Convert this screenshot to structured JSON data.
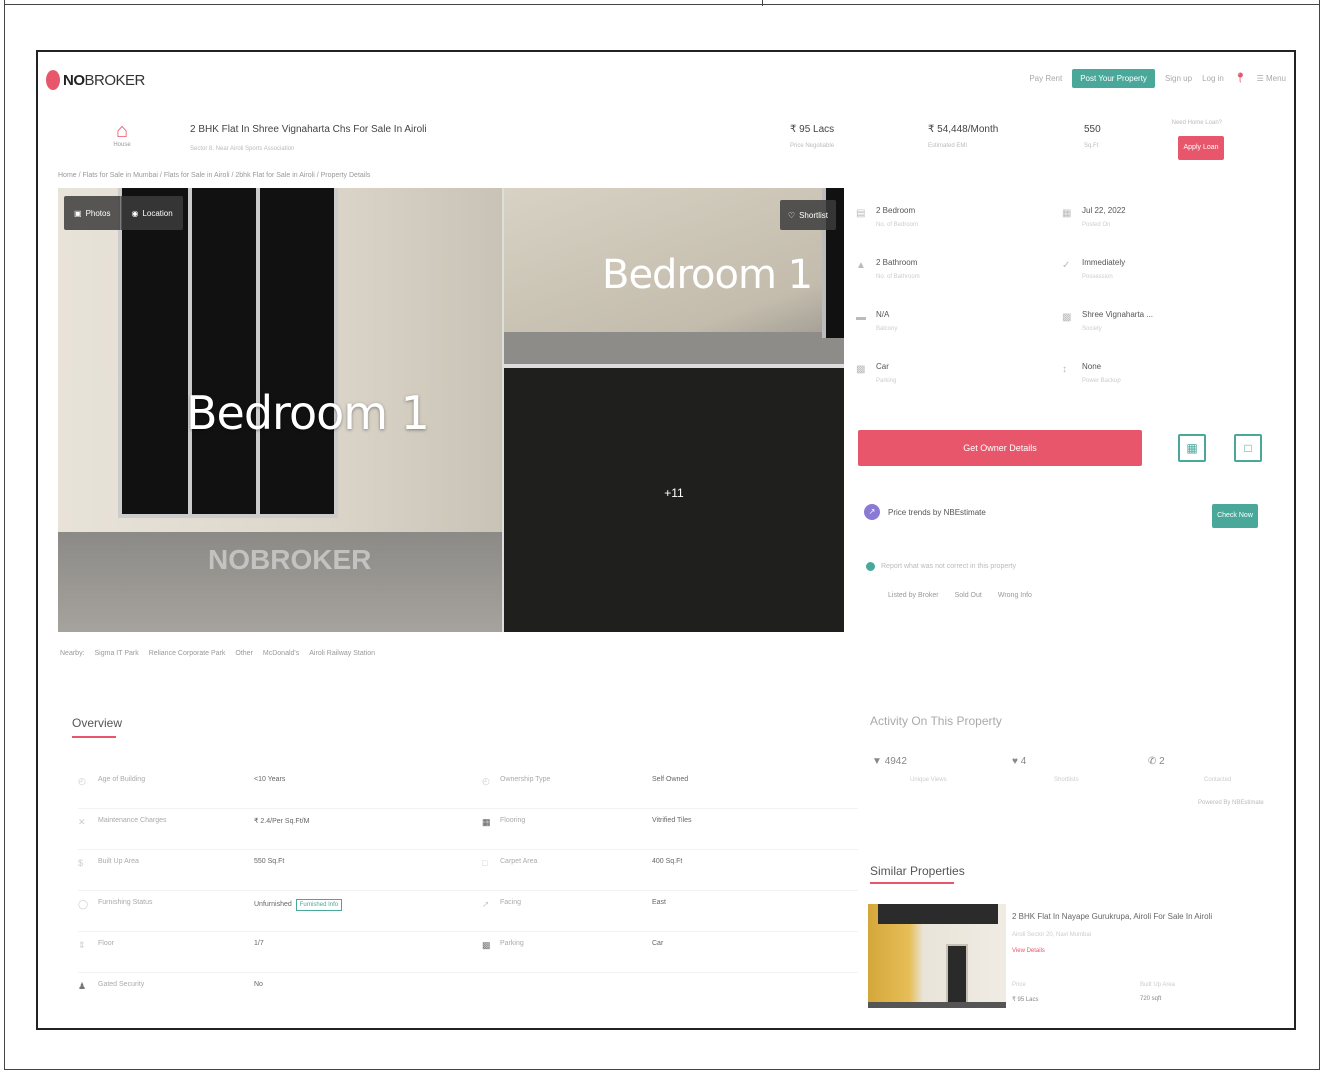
{
  "nav": {
    "logo_brand": "NO",
    "logo_rest": "BROKER",
    "items": [
      "Pay Rent",
      "Post Your Property",
      "Sign up",
      "Log in",
      "Menu"
    ]
  },
  "property": {
    "type_label": "House",
    "title": "2 BHK Flat In Shree Vignaharta Chs For Sale In Airoli",
    "subtitle": "Sector 8, Near Airoli Sports Association",
    "price": "₹ 95 Lacs",
    "price_note": "Price Negotiable",
    "emi": "₹ 54,448/Month",
    "emi_note": "Estimated EMI",
    "area": "550",
    "area_unit": "Sq.Ft",
    "loan_question": "Need Home Loan?",
    "apply_label": "Apply Loan"
  },
  "breadcrumb": "Home / Flats for Sale in Mumbai / Flats for Sale in Airoli / 2bhk Flat for Sale in Airoli / Property Details",
  "gallery": {
    "photos_label": "Photos",
    "location_label": "Location",
    "main_caption": "Bedroom 1",
    "side_caption": "Bedroom 1",
    "watermark": "NOBROKER",
    "shortlist_label": "Shortlist",
    "more_count": "+11"
  },
  "nearby": [
    "Nearby:",
    "Sigma IT Park",
    "Reliance Corporate Park",
    "Other",
    "McDonald's",
    "Airoli Railway Station"
  ],
  "details": [
    {
      "value": "2 Bedroom",
      "label": "No. of Bedroom"
    },
    {
      "value": "Jul 22, 2022",
      "label": "Posted On"
    },
    {
      "value": "2 Bathroom",
      "label": "No. of Bathroom"
    },
    {
      "value": "Immediately",
      "label": "Possession"
    },
    {
      "value": "N/A",
      "label": "Balcony"
    },
    {
      "value": "Shree Vignaharta ...",
      "label": "Society"
    },
    {
      "value": "Car",
      "label": "Parking"
    },
    {
      "value": "None",
      "label": "Power Backup"
    }
  ],
  "actions": {
    "owner_label": "Get Owner Details",
    "trend_label": "Price trends by NBEstimate",
    "check_label": "Check Now",
    "report_label": "Report what was not correct in this property",
    "report_links": [
      "Listed by Broker",
      "Sold Out",
      "Wrong Info"
    ]
  },
  "overview": {
    "title": "Overview",
    "rows": [
      {
        "l1": "Age of Building",
        "v1": "<10 Years",
        "l2": "Ownership Type",
        "v2": "Self Owned"
      },
      {
        "l1": "Maintenance Charges",
        "v1": "₹ 2.4/Per Sq.Ft/M",
        "l2": "Flooring",
        "v2": "Vitrified Tiles"
      },
      {
        "l1": "Built Up Area",
        "v1": "550 Sq.Ft",
        "l2": "Carpet Area",
        "v2": "400 Sq.Ft"
      },
      {
        "l1": "Furnishing Status",
        "v1": "Unfurnished",
        "badge": "Furnished Info",
        "l2": "Facing",
        "v2": "East"
      },
      {
        "l1": "Floor",
        "v1": "1/7",
        "l2": "Parking",
        "v2": "Car"
      },
      {
        "l1": "Gated Security",
        "v1": "No",
        "l2": "",
        "v2": ""
      }
    ]
  },
  "activity": {
    "title": "Activity On This Property",
    "stats": [
      {
        "value": "4942",
        "label": "Unique Views"
      },
      {
        "value": "4",
        "label": "Shortlists"
      },
      {
        "value": "2",
        "label": "Contacted"
      }
    ],
    "powered": "Powered By NBEstimate"
  },
  "similar": {
    "title": "Similar Properties",
    "card": {
      "name": "2 BHK Flat In Nayape Gurukrupa, Airoli For Sale In Airoli",
      "sub": "Airoli Sector 20, Navi Mumbai",
      "link": "View Details",
      "price_label": "Price",
      "price": "₹ 95 Lacs",
      "area_label": "Built Up Area",
      "area": "720 sqft"
    }
  },
  "colors": {
    "accent": "#e8566b",
    "teal": "#4aa89a"
  }
}
